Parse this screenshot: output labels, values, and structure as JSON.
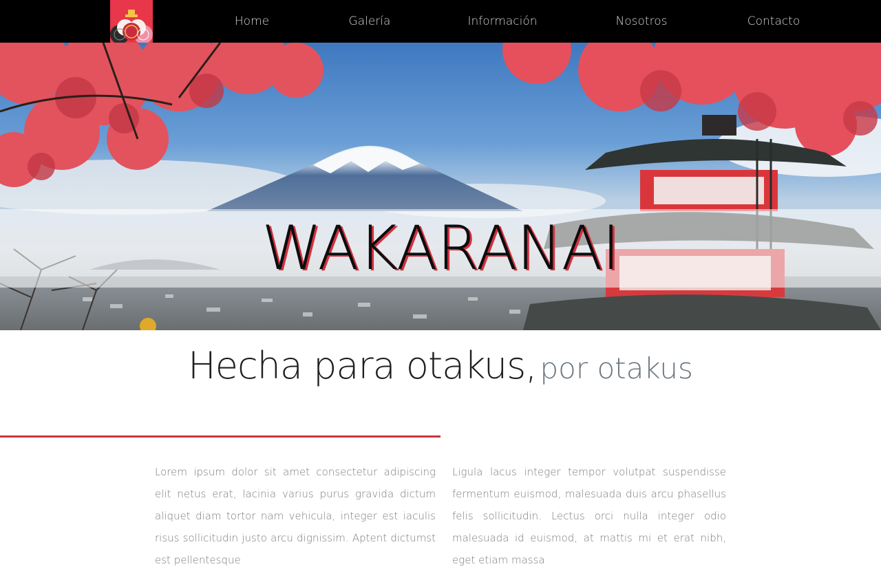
{
  "navbar": {
    "logo_icon": "pagoda-fans-logo-icon",
    "links": [
      {
        "label": "Home"
      },
      {
        "label": "Galería"
      },
      {
        "label": "Información"
      },
      {
        "label": "Nosotros"
      },
      {
        "label": "Contacto"
      }
    ]
  },
  "hero": {
    "title": "WAKARANAI",
    "image": "mount-fuji-pagoda-autumn-scene"
  },
  "tagline": {
    "main": "Hecha para otakus,",
    "sub": "por otakus"
  },
  "content": {
    "left_paragraph": "Lorem ipsum dolor sit amet consectetur adipiscing elit netus erat, lacinia varius purus gravida dictum aliquet diam tortor nam vehicula, integer est iaculis risus sollicitudin justo arcu dignissim. Aptent dictumst est pellentesque",
    "right_paragraph": "Ligula lacus integer tempor volutpat suspendisse fermentum euismod, malesuada duis arcu phasellus felis sollicitudin. Lectus orci nulla integer odio malesuada id euismod, at mattis mi et erat nibh, eget etiam massa"
  },
  "colors": {
    "nav_bg": "#000000",
    "accent_red": "#c9343f",
    "logo_bg": "#e8364a"
  }
}
